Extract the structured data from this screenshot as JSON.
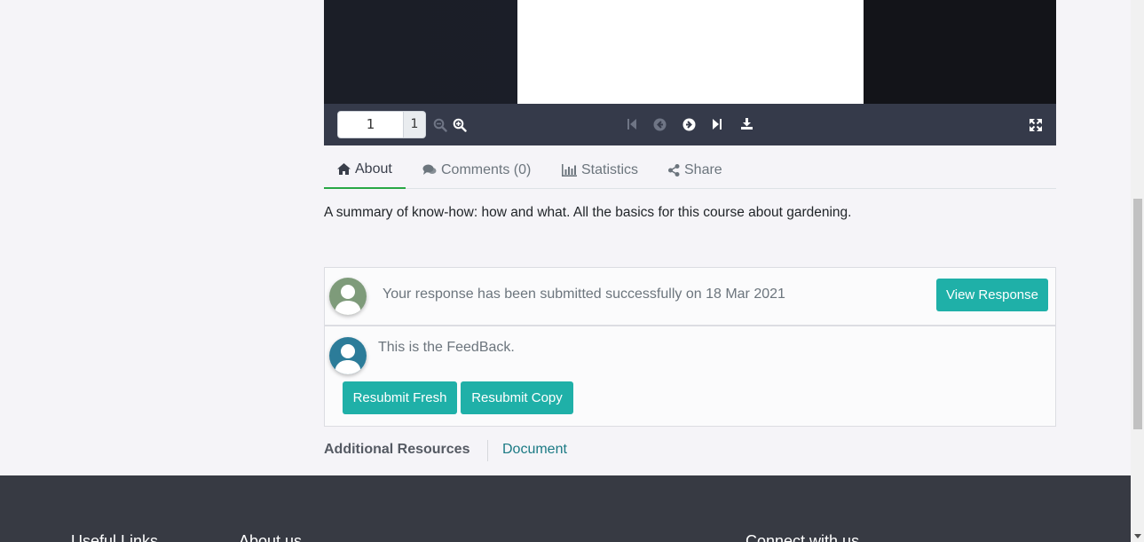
{
  "viewer": {
    "page_value": "1",
    "page_total": "1",
    "icons": [
      "zoom-out-icon",
      "zoom-in-icon",
      "first-page-icon",
      "previous-page-icon",
      "next-page-icon",
      "last-page-icon",
      "download-icon",
      "fullscreen-icon"
    ]
  },
  "tabs": [
    {
      "label": "About",
      "icon": "home-icon",
      "active": true
    },
    {
      "label": "Comments (0)",
      "icon": "comments-icon"
    },
    {
      "label": "Statistics",
      "icon": "bar-chart-icon"
    },
    {
      "label": "Share",
      "icon": "share-icon"
    }
  ],
  "summary": "A summary of know-how: how and what. All the basics for this course about gardening.",
  "response": {
    "text": "Your response has been submitted successfully on 18 Mar 2021",
    "button": "View Response"
  },
  "feedback": {
    "text": "This is the FeedBack.",
    "buttons": [
      "Resubmit Fresh",
      "Resubmit Copy"
    ]
  },
  "resources": {
    "label": "Additional Resources",
    "link": "Document"
  },
  "footer": {
    "headings": [
      "Useful Links",
      "About us",
      "Connect with us"
    ]
  },
  "colors": {
    "accent": "#1fb0a8",
    "tab_active_underline": "#28a745",
    "footer_bg": "#373a43",
    "link": "#1b7a84"
  }
}
